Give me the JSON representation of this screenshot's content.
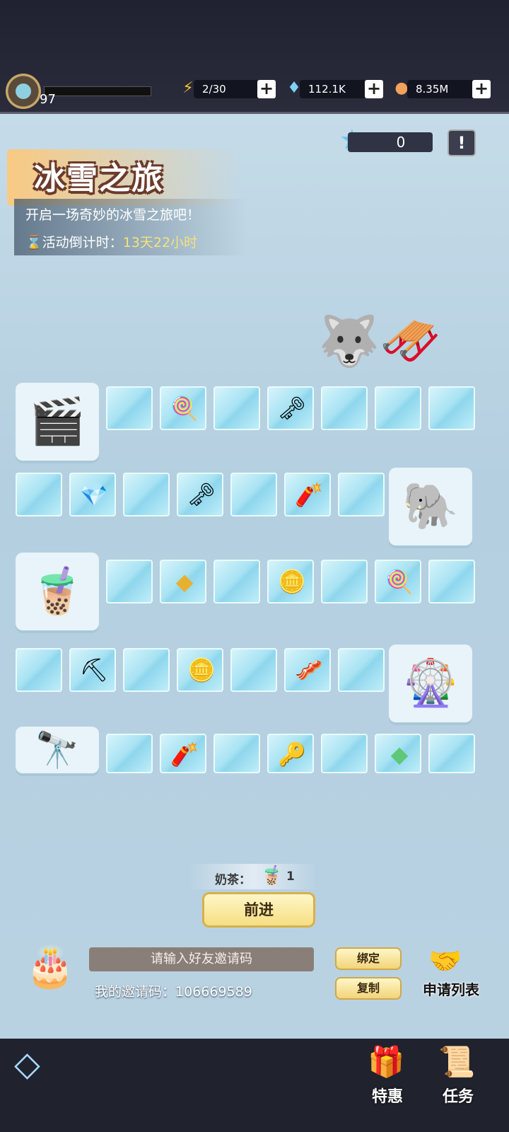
{
  "topbar": {
    "level": "97",
    "energy": "2/30",
    "gems": "112.1K",
    "coins": "8.35M",
    "xp_progress": 0.0
  },
  "event": {
    "title": "冰雪之旅",
    "subtitle": "开启一场奇妙的冰雪之旅吧！",
    "countdown_label": "活动倒计时：",
    "countdown_value": "13天22小时",
    "stars": "0"
  },
  "board": {
    "milk_tea_label": "奶茶：",
    "milk_tea_count": "1",
    "go_button": "前进"
  },
  "invite": {
    "input_placeholder": "请输入好友邀请码",
    "my_code_label": "我的邀请码：106669589",
    "bind_button": "绑定",
    "copy_button": "复制",
    "apply_list": "申请列表"
  },
  "nav": {
    "special": "特惠",
    "task": "任务"
  }
}
